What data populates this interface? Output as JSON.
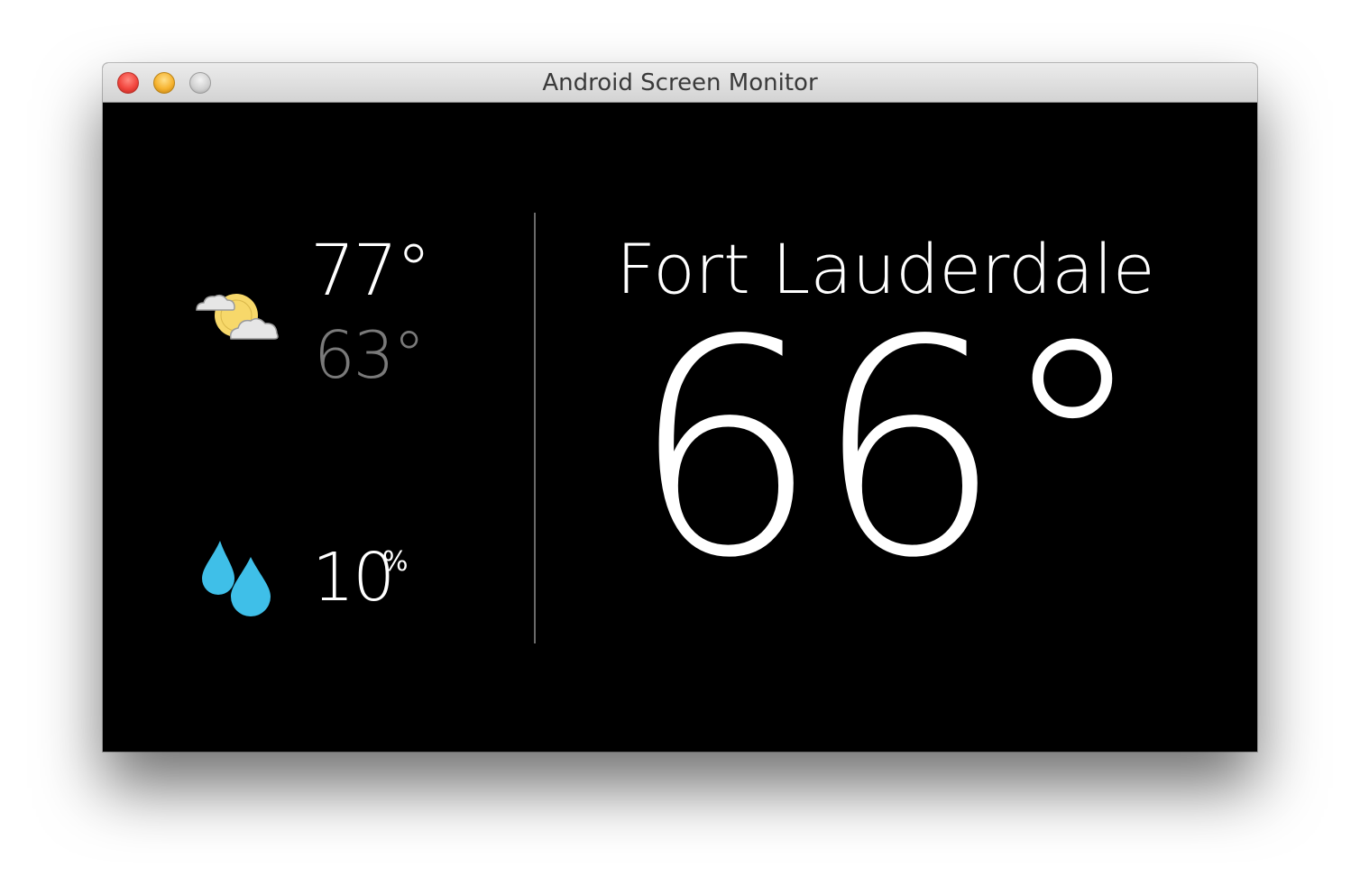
{
  "window": {
    "title": "Android Screen Monitor"
  },
  "weather": {
    "condition_icon": "partly-cloudy-icon",
    "high_temp": "77°",
    "low_temp": "63°",
    "precip_icon": "raindrops-icon",
    "precip_value": "10",
    "precip_unit": "%",
    "city": "Fort Lauderdale",
    "current_temp": "66°"
  },
  "colors": {
    "background": "#000000",
    "primary_text": "#ffffff",
    "secondary_text": "#7a7a7a",
    "sun": "#f7d86a",
    "rain": "#3fbfe8"
  }
}
